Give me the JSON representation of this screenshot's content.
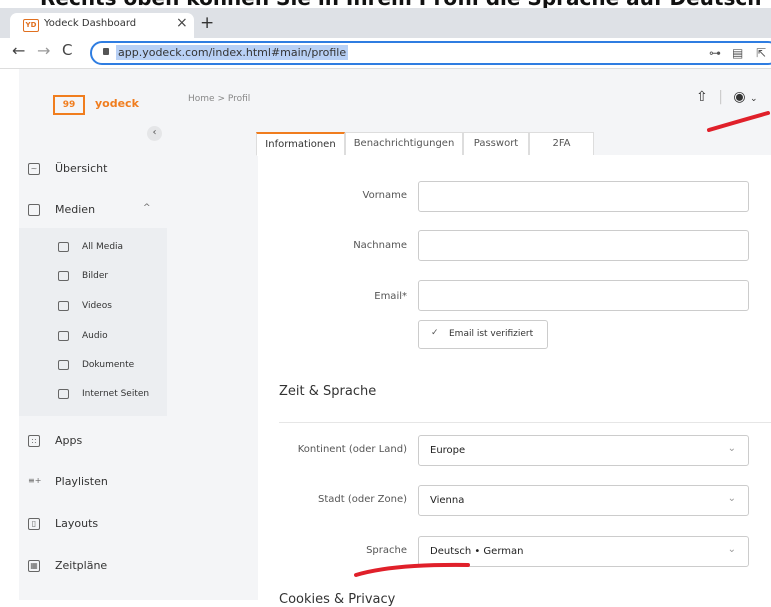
{
  "caption_text": "Rechts oben können Sie in Ihrem Profil die Sprache auf Deutsch",
  "browser": {
    "tab_title": "Yodeck Dashboard",
    "tab_favicon_text": "YD",
    "url": "app.yodeck.com/index.html#main/profile"
  },
  "app": {
    "logo_mark": "99",
    "logo_text": "yodeck",
    "breadcrumb": "Home > Profil",
    "sidebar": {
      "items": [
        {
          "label": "Übersicht",
          "icon": "chart-icon"
        },
        {
          "label": "Medien",
          "icon": "folder-icon",
          "expanded": true
        },
        {
          "label": "Apps",
          "icon": "grid-icon"
        },
        {
          "label": "Playlisten",
          "icon": "playlist-icon"
        },
        {
          "label": "Layouts",
          "icon": "layout-icon"
        },
        {
          "label": "Zeitpläne",
          "icon": "calendar-icon"
        }
      ],
      "media_subitems": [
        {
          "label": "All Media",
          "icon": "folder-icon"
        },
        {
          "label": "Bilder",
          "icon": "image-icon"
        },
        {
          "label": "Videos",
          "icon": "video-icon"
        },
        {
          "label": "Audio",
          "icon": "speaker-icon"
        },
        {
          "label": "Dokumente",
          "icon": "document-icon"
        },
        {
          "label": "Internet Seiten",
          "icon": "browser-icon"
        }
      ]
    },
    "tabs": [
      {
        "label": "Informationen",
        "active": true
      },
      {
        "label": "Benachrichtigungen"
      },
      {
        "label": "Passwort"
      },
      {
        "label": "2FA"
      }
    ],
    "form": {
      "vorname_label": "Vorname",
      "vorname_value": "",
      "nachname_label": "Nachname",
      "nachname_value": "",
      "email_label": "Email*",
      "email_value": "",
      "verified_label": "Email ist verifiziert",
      "section_time_language": "Zeit & Sprache",
      "continent_label": "Kontinent (oder Land)",
      "continent_value": "Europe",
      "city_label": "Stadt (oder Zone)",
      "city_value": "Vienna",
      "language_label": "Sprache",
      "language_value": "Deutsch • German",
      "section_cookies": "Cookies & Privacy"
    }
  },
  "colors": {
    "brand": "#f07d1e",
    "annotation": "#e0202a",
    "url_focus": "#2f7de1"
  }
}
